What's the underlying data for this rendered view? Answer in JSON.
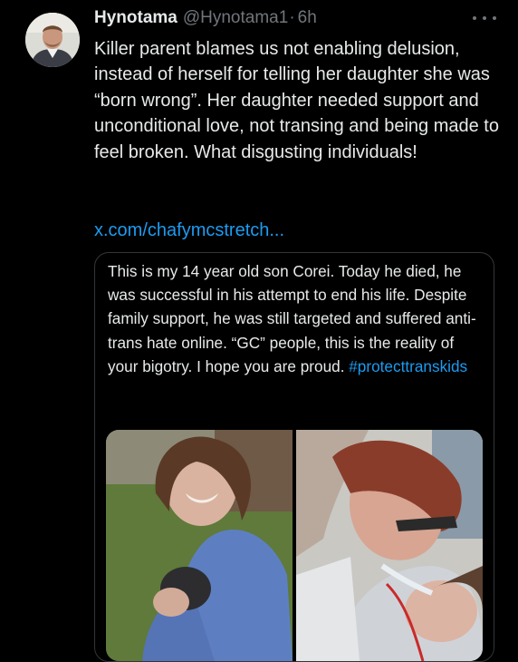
{
  "tweet": {
    "display_name": "Hynotama",
    "handle": "@Hynotama1",
    "separator": "·",
    "time": "6h",
    "body": "Killer parent blames us not enabling delusion, instead of herself for telling her daughter she was “born wrong”. Her daughter needed support and unconditional love, not transing and being made to feel broken. What disgusting individuals!",
    "link": "x.com/chafymcstretch..."
  },
  "quote": {
    "text": "This is my 14 year old son Corei. Today he died, he was successful in his attempt to end his life. Despite family support, he was still targeted and suffered anti-trans hate online. “GC” people, this is the reality of your bigotry. I hope you are proud. ",
    "hashtag": "#protecttranskids"
  },
  "icons": {
    "more": "more-options-icon",
    "avatar": "user-avatar"
  },
  "colors": {
    "background": "#000000",
    "text": "#e7e9ea",
    "muted": "#71767b",
    "accent": "#1d9bf0",
    "border": "#333639"
  }
}
